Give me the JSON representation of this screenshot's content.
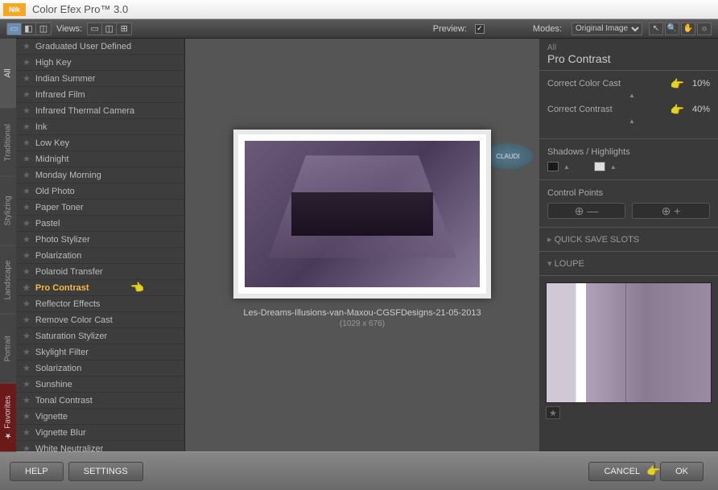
{
  "app": {
    "title": "Color Efex Pro™ 3.0",
    "logo": "Nik"
  },
  "toolbar": {
    "views_label": "Views:",
    "preview_label": "Preview:",
    "preview_checked": "✓",
    "modes_label": "Modes:",
    "modes_value": "Original Image"
  },
  "vtabs": [
    "All",
    "Traditional",
    "Stylizing",
    "Landscape",
    "Portrait",
    "★ Favorites"
  ],
  "filters": [
    "Graduated User Defined",
    "High Key",
    "Indian Summer",
    "Infrared Film",
    "Infrared Thermal Camera",
    "Ink",
    "Low Key",
    "Midnight",
    "Monday Morning",
    "Old Photo",
    "Paper Toner",
    "Pastel",
    "Photo Stylizer",
    "Polarization",
    "Polaroid Transfer",
    "Pro Contrast",
    "Reflector Effects",
    "Remove Color Cast",
    "Saturation Stylizer",
    "Skylight Filter",
    "Solarization",
    "Sunshine",
    "Tonal Contrast",
    "Vignette",
    "Vignette Blur",
    "White Neutralizer"
  ],
  "selected_filter": "Pro Contrast",
  "preview": {
    "filename": "Les-Dreams-Illusions-van-Maxou-CGSFDesigns-21-05-2013",
    "dimensions": "(1029 x 676)",
    "watermark": "CLAUDI"
  },
  "panel": {
    "all": "All",
    "name": "Pro Contrast",
    "controls": [
      {
        "label": "Correct Color Cast",
        "value": "10%"
      },
      {
        "label": "Correct Contrast",
        "value": "40%"
      }
    ],
    "shadows_label": "Shadows / Highlights",
    "control_points_label": "Control Points",
    "quick_save": "QUICK SAVE SLOTS",
    "loupe": "LOUPE"
  },
  "footer": {
    "help": "HELP",
    "settings": "SETTINGS",
    "cancel": "CANCEL",
    "ok": "OK"
  }
}
